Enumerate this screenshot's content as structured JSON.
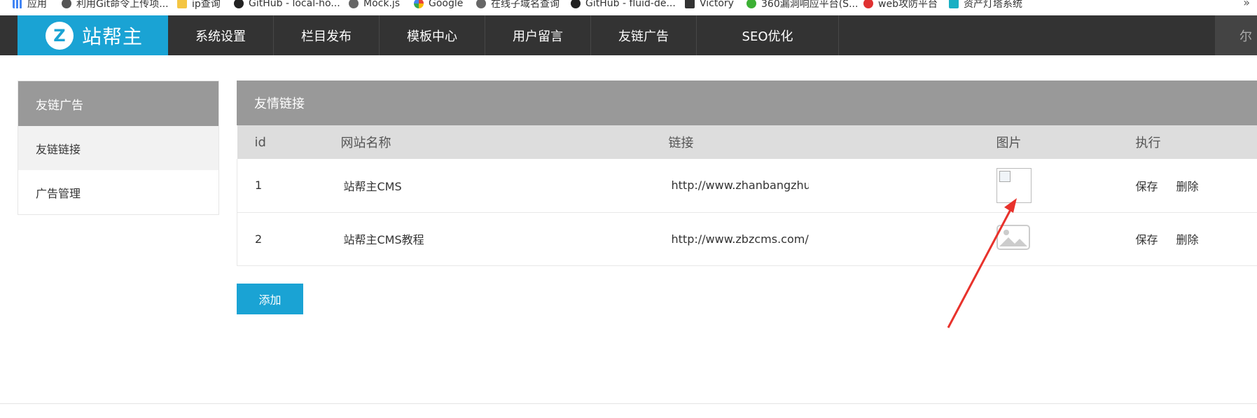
{
  "bookmarks": {
    "items": [
      {
        "label": "应用",
        "icon": "apps-grid-icon",
        "color": "#4285f4"
      },
      {
        "label": "利用Git命令上传项...",
        "icon": "git-icon",
        "color": "#555555"
      },
      {
        "label": "ip查询",
        "icon": "folder-icon",
        "color": "#f4c542"
      },
      {
        "label": "GitHub - local-ho...",
        "icon": "github-icon",
        "color": "#222222"
      },
      {
        "label": "Mock.js",
        "icon": "globe-icon",
        "color": "#666666"
      },
      {
        "label": "Google",
        "icon": "google-icon",
        "color": "#4285f4"
      },
      {
        "label": "在线子域名查询",
        "icon": "globe-icon",
        "color": "#666666"
      },
      {
        "label": "GitHub - fluid-de...",
        "icon": "github-icon",
        "color": "#222222"
      },
      {
        "label": "Victory",
        "icon": "victory-icon",
        "color": "#333333"
      },
      {
        "label": "360漏洞响应平台(S...",
        "icon": "360-icon",
        "color": "#3cb034"
      },
      {
        "label": "web攻防平台",
        "icon": "web-attack-icon",
        "color": "#e03131"
      },
      {
        "label": "资产灯塔系统",
        "icon": "lighthouse-icon",
        "color": "#1ab0c4"
      }
    ],
    "more": "»"
  },
  "header": {
    "logo_letter": "Z",
    "logo_text": "站帮主",
    "nav": [
      "系统设置",
      "栏目发布",
      "模板中心",
      "用户留言",
      "友链广告",
      "SEO优化"
    ],
    "right_text": "尔"
  },
  "sidebar": {
    "title": "友链广告",
    "items": [
      {
        "label": "友链链接",
        "active": true
      },
      {
        "label": "广告管理",
        "active": false
      }
    ]
  },
  "main": {
    "title": "友情链接",
    "columns": [
      "id",
      "网站名称",
      "链接",
      "图片",
      "执行"
    ],
    "rows": [
      {
        "id": "1",
        "name": "站帮主CMS",
        "link": "http://www.zhanbangzhu.com/",
        "image": "broken",
        "save": "保存",
        "delete": "删除"
      },
      {
        "id": "2",
        "name": "站帮主CMS教程",
        "link": "http://www.zbzcms.com/",
        "image": "placeholder",
        "save": "保存",
        "delete": "删除"
      }
    ],
    "add_button": "添加"
  },
  "colors": {
    "accent": "#1aa3d4",
    "nav_bg": "#333333",
    "panel_header": "#999999",
    "annotation_arrow": "#e8322c"
  }
}
